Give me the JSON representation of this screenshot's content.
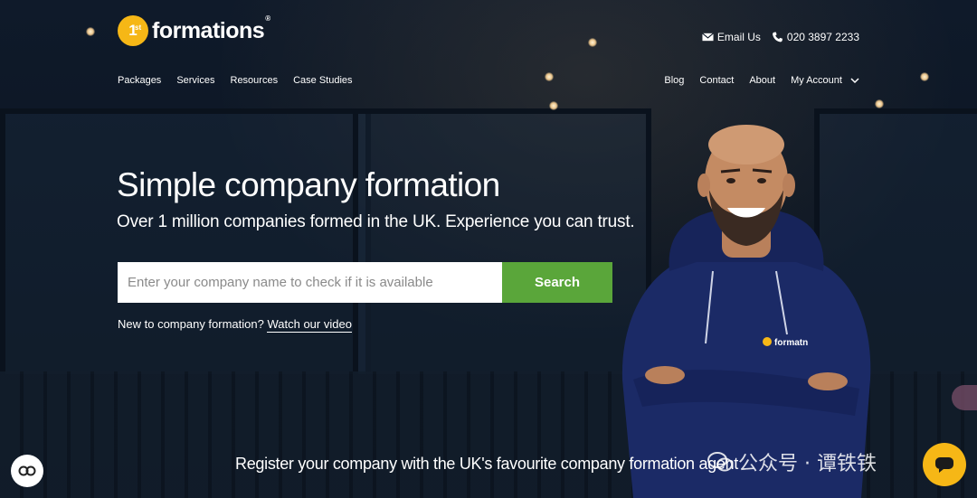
{
  "brand": {
    "badge_text": "1",
    "badge_sup": "st",
    "name": "formations",
    "reg_mark": "®",
    "accent_color": "#f6b716"
  },
  "contact": {
    "email_label": "Email Us",
    "phone_label": "020 3897 2233",
    "email_icon": "envelope-icon",
    "phone_icon": "phone-icon"
  },
  "nav_left": [
    "Packages",
    "Services",
    "Resources",
    "Case Studies"
  ],
  "nav_right": {
    "blog": "Blog",
    "contact": "Contact",
    "about": "About",
    "account": "My Account"
  },
  "hero": {
    "headline": "Simple company formation",
    "subline": "Over 1 million companies formed in the UK. Experience you can trust.",
    "search_placeholder": "Enter your company name to check if it is available",
    "search_button": "Search",
    "search_button_color": "#5aa63a",
    "newto_text": "New to company formation?",
    "newto_link": "Watch our video",
    "tagline": "Register your company with the UK's favourite company formation agent"
  },
  "hoodie_logo_text": "formatn",
  "watermark": {
    "text": "公众号 · 谭铁铁"
  }
}
